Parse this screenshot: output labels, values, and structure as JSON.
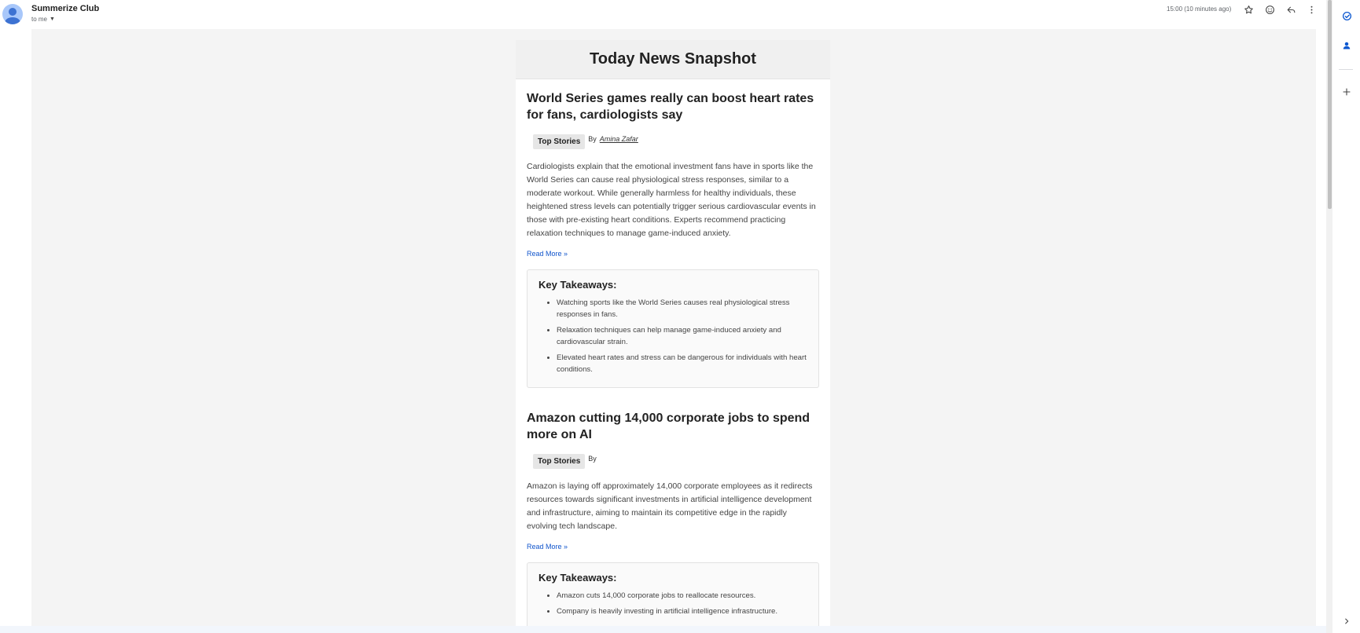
{
  "email": {
    "sender": "Summerize Club",
    "to": "to me",
    "time": "15:00 (10 minutes ago)"
  },
  "header_icons": [
    "star-icon",
    "emoji-icon",
    "reply-icon",
    "more-vert-icon"
  ],
  "rail_icons": [
    "tasks-icon",
    "contacts-icon",
    "add-icon",
    "chevron-right-icon"
  ],
  "newsletter": {
    "title": "Today News Snapshot",
    "articles": [
      {
        "title": "World Series games really can boost heart rates for fans, cardiologists say",
        "tag": "Top Stories",
        "by": "By",
        "author": "Amina Zafar",
        "summary": "Cardiologists explain that the emotional investment fans have in sports like the World Series can cause real physiological stress responses, similar to a moderate workout. While generally harmless for healthy individuals, these heightened stress levels can potentially trigger serious cardiovascular events in those with pre-existing heart conditions. Experts recommend practicing relaxation techniques to manage game-induced anxiety.",
        "read_more": "Read More »",
        "takeaways_title": "Key Takeaways:",
        "takeaways": [
          "Watching sports like the World Series causes real physiological stress responses in fans.",
          "Relaxation techniques can help manage game-induced anxiety and cardiovascular strain.",
          "Elevated heart rates and stress can be dangerous for individuals with heart conditions."
        ]
      },
      {
        "title": "Amazon cutting 14,000 corporate jobs to spend more on AI",
        "tag": "Top Stories",
        "by": "By",
        "author": "",
        "summary": "Amazon is laying off approximately 14,000 corporate employees as it redirects resources towards significant investments in artificial intelligence development and infrastructure, aiming to maintain its competitive edge in the rapidly evolving tech landscape.",
        "read_more": "Read More »",
        "takeaways_title": "Key Takeaways:",
        "takeaways": [
          "Amazon cuts 14,000 corporate jobs to reallocate resources.",
          "Company is heavily investing in artificial intelligence infrastructure."
        ]
      }
    ]
  },
  "colors": {
    "link": "#1155cc",
    "rail_accent": "#0b57d0",
    "canvas_bg": "#f4f4f4"
  }
}
